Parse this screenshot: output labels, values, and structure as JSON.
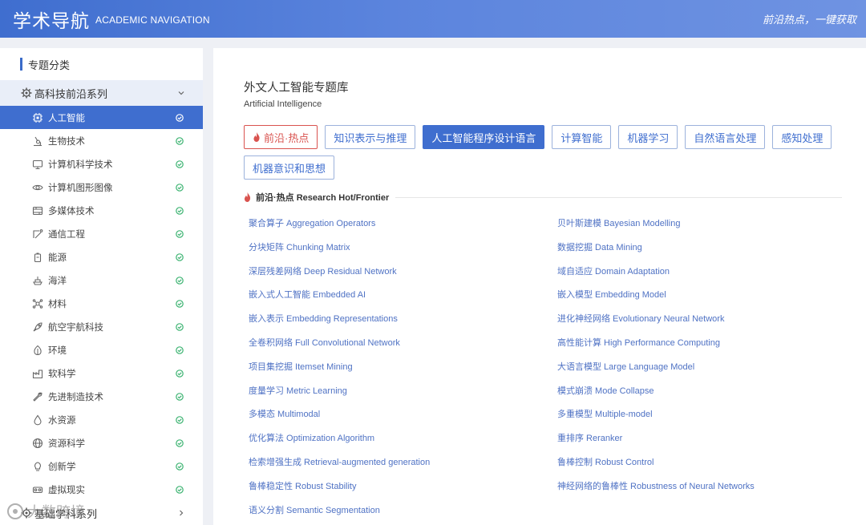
{
  "header": {
    "brand_cn": "学术导航",
    "brand_en": "ACADEMIC NAVIGATION",
    "slogan": "前沿热点，一键获取"
  },
  "sidebar": {
    "title": "专题分类",
    "group_top": {
      "label": "高科技前沿系列",
      "icon": "gear-icon",
      "state": "expanded"
    },
    "items": [
      {
        "label": "人工智能",
        "icon": "chip-icon",
        "active": true
      },
      {
        "label": "生物技术",
        "icon": "microscope-icon"
      },
      {
        "label": "计算机科学技术",
        "icon": "monitor-icon"
      },
      {
        "label": "计算机图形图像",
        "icon": "eye-icon"
      },
      {
        "label": "多媒体技术",
        "icon": "film-icon"
      },
      {
        "label": "通信工程",
        "icon": "antenna-icon"
      },
      {
        "label": "能源",
        "icon": "battery-icon"
      },
      {
        "label": "海洋",
        "icon": "ship-icon"
      },
      {
        "label": "材料",
        "icon": "molecule-icon"
      },
      {
        "label": "航空宇航科技",
        "icon": "rocket-icon"
      },
      {
        "label": "环境",
        "icon": "leaf-icon"
      },
      {
        "label": "软科学",
        "icon": "factory-icon"
      },
      {
        "label": "先进制造技术",
        "icon": "wrench-icon"
      },
      {
        "label": "水资源",
        "icon": "water-drop-icon"
      },
      {
        "label": "资源科学",
        "icon": "globe-icon"
      },
      {
        "label": "创新学",
        "icon": "bulb-icon"
      },
      {
        "label": "虚拟现实",
        "icon": "vr-headset-icon"
      }
    ],
    "group_bottom": {
      "label": "基础学科系列",
      "icon": "gear-icon",
      "state": "collapsed"
    }
  },
  "main": {
    "title_cn": "外文人工智能专题库",
    "title_en": "Artificial Intelligence",
    "tabs": [
      {
        "label": "前沿·热点",
        "type": "hot"
      },
      {
        "label": "知识表示与推理"
      },
      {
        "label": "人工智能程序设计语言",
        "active": true
      },
      {
        "label": "计算智能"
      },
      {
        "label": "机器学习"
      },
      {
        "label": "自然语言处理"
      },
      {
        "label": "感知处理"
      },
      {
        "label": "机器意识和思想"
      }
    ],
    "section_title": "前沿·热点 Research Hot/Frontier",
    "terms": [
      "聚合算子 Aggregation Operators",
      "贝叶斯建模 Bayesian Modelling",
      "分块矩阵 Chunking Matrix",
      "数据挖掘 Data Mining",
      "深层残差网络 Deep Residual Network",
      "域自适应 Domain Adaptation",
      "嵌入式人工智能 Embedded AI",
      "嵌入模型 Embedding Model",
      "嵌入表示 Embedding Representations",
      "进化神经网络 Evolutionary Neural Network",
      "全卷积网络 Full Convolutional Network",
      "高性能计算 High Performance Computing",
      "项目集挖掘 Itemset Mining",
      "大语言模型 Large Language Model",
      "度量学习 Metric Learning",
      "模式崩溃 Mode Collapse",
      "多模态 Multimodal",
      "多重模型 Multiple-model",
      "优化算法 Optimization Algorithm",
      "重排序 Reranker",
      "检索增强生成 Retrieval-augmented generation",
      "鲁棒控制 Robust Control",
      "鲁棒稳定性 Robust Stability",
      "神经网络的鲁棒性 Robustness of Neural Networks",
      "语义分割 Semantic Segmentation"
    ]
  },
  "watermark": {
    "text": "大数跨境"
  },
  "colors": {
    "primary": "#3f6ecf",
    "hot": "#d9534f",
    "check": "#3cb371",
    "link": "#4f72c4"
  }
}
